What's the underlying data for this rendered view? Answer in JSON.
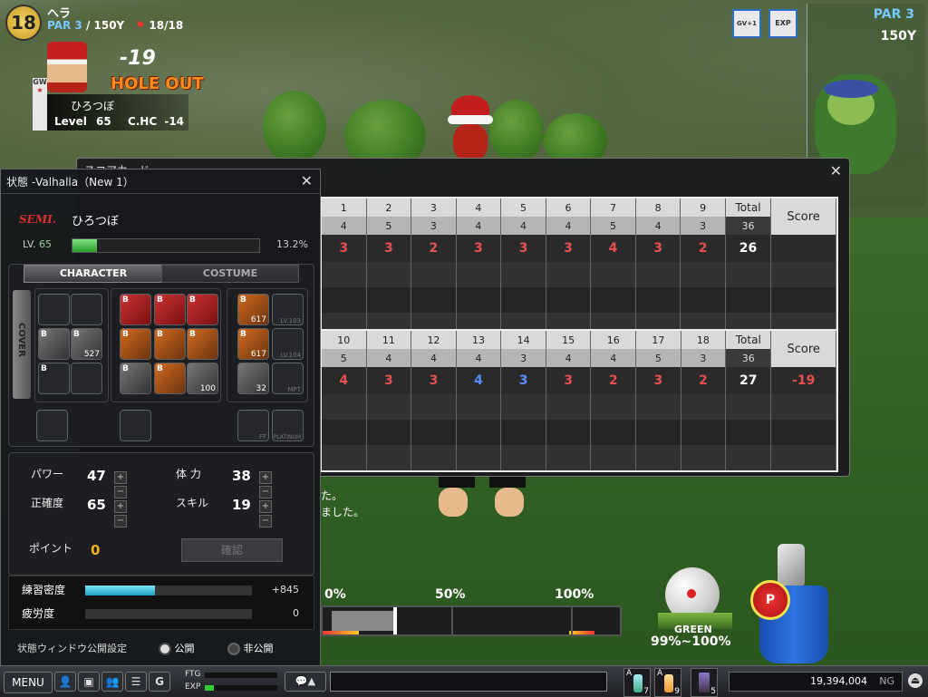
{
  "hud": {
    "hole_number": "18",
    "course": "ヘラ",
    "par_label": "PAR 3",
    "distance": "/ 150Y",
    "flag_count": "18/18",
    "score_big": "-19",
    "holeout": "HOLE OUT",
    "player_name": "ひろつぼ",
    "level_label": "Level",
    "level_value": "65",
    "chc_label": "C.HC",
    "chc_value": "-14",
    "gw_badge": "GW",
    "minimap_par": "PAR 3",
    "minimap_dist": "150Y",
    "icon_gv": "GV+1",
    "icon_exp": "EXP"
  },
  "status_window": {
    "title": "状態 -Valhalla（New 1）",
    "rank_badge": "SEMI.",
    "player_name": "ひろつぼ",
    "lv_label": "LV.",
    "lv_value": "65",
    "exp_percent_text": "13.2%",
    "exp_fraction": 0.132,
    "tab_character": "CHARACTER",
    "tab_costume": "COSTUME",
    "cover_label": "COVER",
    "slot_counts": {
      "glove": "527",
      "ball": "100",
      "cap_a": "617",
      "cap_b": "617",
      "ring": "32",
      "lock1": "LV.103",
      "lock2": "LV.104",
      "lock3": "MPT",
      "ff": "FF",
      "platinum": "PLATINUM"
    },
    "stats": {
      "power_label": "パワー",
      "power_value": "47",
      "stamina_label": "体 力",
      "stamina_value": "38",
      "accuracy_label": "正確度",
      "accuracy_value": "65",
      "skill_label": "スキル",
      "skill_value": "19"
    },
    "point_label": "ポイント",
    "point_value": "0",
    "confirm_label": "確認",
    "practice_label": "練習密度",
    "practice_value": "+845",
    "practice_fraction": 0.42,
    "fatigue_label": "疲労度",
    "fatigue_value": "0",
    "visibility_label": "状態ウィンドウ公開設定",
    "public_label": "公開",
    "private_label": "非公開"
  },
  "scorecard": {
    "title": "スコアカード",
    "front": {
      "holes": [
        "1",
        "2",
        "3",
        "4",
        "5",
        "6",
        "7",
        "8",
        "9"
      ],
      "pars": [
        "4",
        "5",
        "3",
        "4",
        "4",
        "4",
        "5",
        "4",
        "3"
      ],
      "scores": [
        "3",
        "3",
        "2",
        "3",
        "3",
        "3",
        "4",
        "3",
        "2"
      ],
      "total_label": "Total",
      "total_par": "36",
      "total_score": "26",
      "score_label": "Score",
      "score_value": ""
    },
    "back": {
      "holes": [
        "10",
        "11",
        "12",
        "13",
        "14",
        "15",
        "16",
        "17",
        "18"
      ],
      "pars": [
        "5",
        "4",
        "4",
        "4",
        "3",
        "4",
        "4",
        "5",
        "3"
      ],
      "scores": [
        "4",
        "3",
        "3",
        "4",
        "3",
        "3",
        "2",
        "3",
        "2"
      ],
      "total_label": "Total",
      "total_par": "36",
      "total_score": "27",
      "score_label": "Score",
      "score_value": "-19"
    },
    "colors": {
      "under": "#e85050",
      "even": "#5a8cff",
      "white": "#ffffff"
    }
  },
  "power_bar": {
    "p0": "0%",
    "p50": "50%",
    "p100": "100%"
  },
  "green_label": "GREEN",
  "green_percent": "99%~100%",
  "chat_fragments": [
    "た。",
    "ました。"
  ],
  "bottom": {
    "menu_label": "MENU",
    "g_label": "G",
    "ftg_label": "FTG",
    "exp_label": "EXP",
    "item_a1_count": "7",
    "item_a2_count": "9",
    "item_3_count": "5",
    "item_a_label": "A",
    "money": "19,394,004",
    "currency": "NG"
  }
}
